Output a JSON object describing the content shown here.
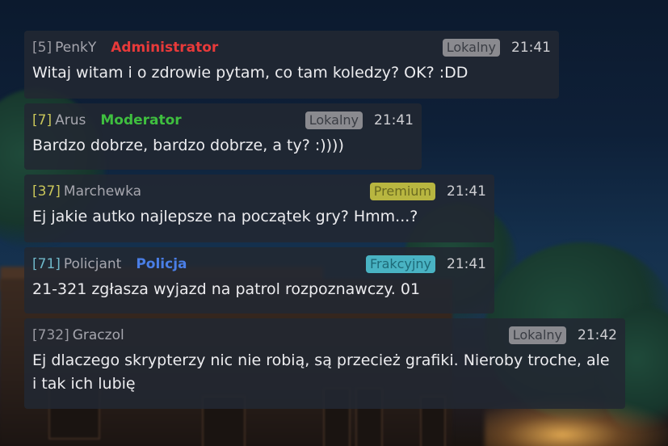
{
  "messages": [
    {
      "id": "[5]",
      "name": "PenkY",
      "role": "Administrator",
      "badge": "Lokalny",
      "time": "21:41",
      "text": "Witaj witam i o zdrowie pytam, co tam koledzy? OK? :DD"
    },
    {
      "id": "[7]",
      "name": "Arus",
      "role": "Moderator",
      "badge": "Lokalny",
      "time": "21:41",
      "text": "Bardzo dobrze, bardzo dobrze, a ty? :))))"
    },
    {
      "id": "[37]",
      "name": "Marchewka",
      "role": "",
      "badge": "Premium",
      "time": "21:41",
      "text": "Ej jakie autko najlepsze na początek gry? Hmm...?"
    },
    {
      "id": "[71]",
      "name": "Policjant",
      "role": "Policja",
      "badge": "Frakcyjny",
      "time": "21:41",
      "text": "21-321 zgłasza wyjazd na patrol rozpoznawczy. 01"
    },
    {
      "id": "[732]",
      "name": "Graczol",
      "role": "",
      "badge": "Lokalny",
      "time": "21:42",
      "text": "Ej dlaczego skrypterzy nic nie robią, są przecież grafiki. Nieroby troche, ale i tak ich lubię"
    }
  ],
  "colors": {
    "administrator": "#e83a3a",
    "moderator": "#3fbf3f",
    "policja": "#4a7ee6",
    "badge_local": "#8a8a8f",
    "badge_premium": "#b8b640",
    "badge_faction": "#49b3c3",
    "panel": "#222832"
  }
}
